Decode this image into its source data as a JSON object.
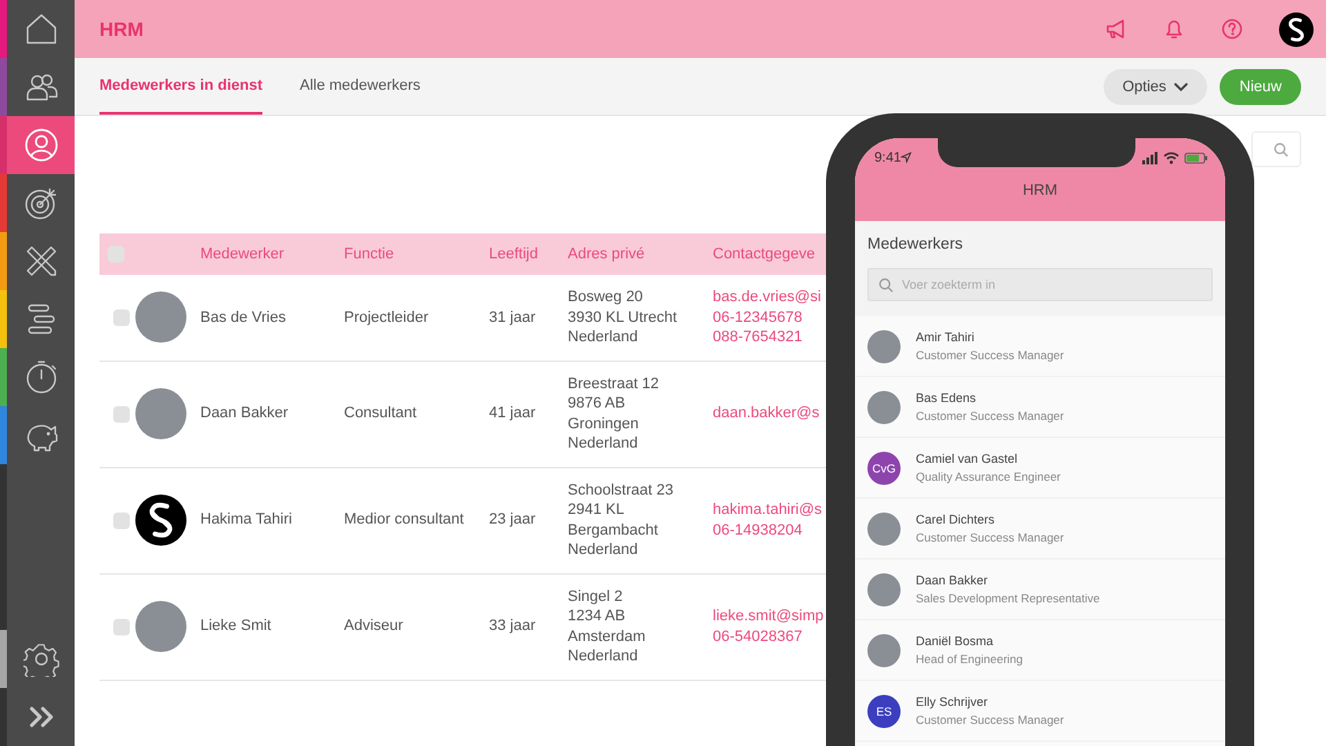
{
  "sidebar": {
    "items": [
      {
        "color": "#e5197e",
        "selected": false
      },
      {
        "color": "#8e4a9e",
        "selected": false
      },
      {
        "color": "#d6306a",
        "selected": true
      },
      {
        "color": "#e53935",
        "selected": false
      },
      {
        "color": "#f39c12",
        "selected": false
      },
      {
        "color": "#f4c20d",
        "selected": false
      },
      {
        "color": "#4caf50",
        "selected": false
      },
      {
        "color": "#2e86de",
        "selected": false
      }
    ],
    "bottom_items": [
      {
        "color": "#a6a6a6",
        "selected": false
      },
      {
        "color": "#333333",
        "selected": false
      }
    ]
  },
  "header": {
    "title": "HRM"
  },
  "tabs": [
    {
      "label": "Medewerkers in dienst",
      "selected": true
    },
    {
      "label": "Alle medewerkers",
      "selected": false
    }
  ],
  "buttons": {
    "options": {
      "label": "Opties"
    },
    "new": {
      "label": "Nieuw"
    }
  },
  "table": {
    "header_checked": false,
    "columns": [
      "Medewerker",
      "Functie",
      "Leeftijd",
      "Adres privé",
      "Contactgegeve"
    ],
    "rows": [
      {
        "checked": false,
        "avatar": {
          "kind": "photo"
        },
        "name": "Bas de Vries",
        "function": "Projectleider",
        "age": "31 jaar",
        "address": [
          "Bosweg 20",
          "3930 KL Utrecht",
          "Nederland"
        ],
        "contact": [
          "bas.de.vries@si",
          "06-12345678",
          "088-7654321"
        ]
      },
      {
        "checked": false,
        "avatar": {
          "kind": "photo"
        },
        "name": "Daan Bakker",
        "function": "Consultant",
        "age": "41 jaar",
        "address": [
          "Breestraat 12",
          "9876 AB",
          "Groningen",
          "Nederland"
        ],
        "contact": [
          "daan.bakker@s"
        ]
      },
      {
        "checked": false,
        "avatar": {
          "kind": "logo"
        },
        "name": "Hakima Tahiri",
        "function": "Medior consultant",
        "age": "23 jaar",
        "address": [
          "Schoolstraat 23",
          "2941 KL",
          "Bergambacht",
          "Nederland"
        ],
        "contact": [
          "hakima.tahiri@s",
          "06-14938204"
        ]
      },
      {
        "checked": false,
        "avatar": {
          "kind": "photo"
        },
        "name": "Lieke Smit",
        "function": "Adviseur",
        "age": "33 jaar",
        "address": [
          "Singel 2",
          "1234 AB",
          "Amsterdam",
          "Nederland"
        ],
        "contact": [
          "lieke.smit@simp",
          "06-54028367"
        ]
      }
    ]
  },
  "phone": {
    "time": "9:41",
    "title": "HRM",
    "heading": "Medewerkers",
    "search": {
      "placeholder": "Voer zoekterm in"
    },
    "people": [
      {
        "name": "Amir Tahiri",
        "role": "Customer Success Manager",
        "avatar": {
          "kind": "photo"
        }
      },
      {
        "name": "Bas Edens",
        "role": "Customer Success Manager",
        "avatar": {
          "kind": "photo"
        }
      },
      {
        "name": "Camiel van Gastel",
        "role": "Quality Assurance Engineer",
        "avatar": {
          "kind": "initials",
          "initials": "CvG",
          "color": "#8e44ad"
        }
      },
      {
        "name": "Carel Dichters",
        "role": "Customer Success Manager",
        "avatar": {
          "kind": "photo"
        }
      },
      {
        "name": "Daan Bakker",
        "role": "Sales Development Representative",
        "avatar": {
          "kind": "photo"
        }
      },
      {
        "name": "Daniël Bosma",
        "role": "Head of Engineering",
        "avatar": {
          "kind": "photo"
        }
      },
      {
        "name": "Elly Schrijver",
        "role": "Customer Success Manager",
        "avatar": {
          "kind": "initials",
          "initials": "ES",
          "color": "#3b3fbf"
        }
      }
    ]
  }
}
